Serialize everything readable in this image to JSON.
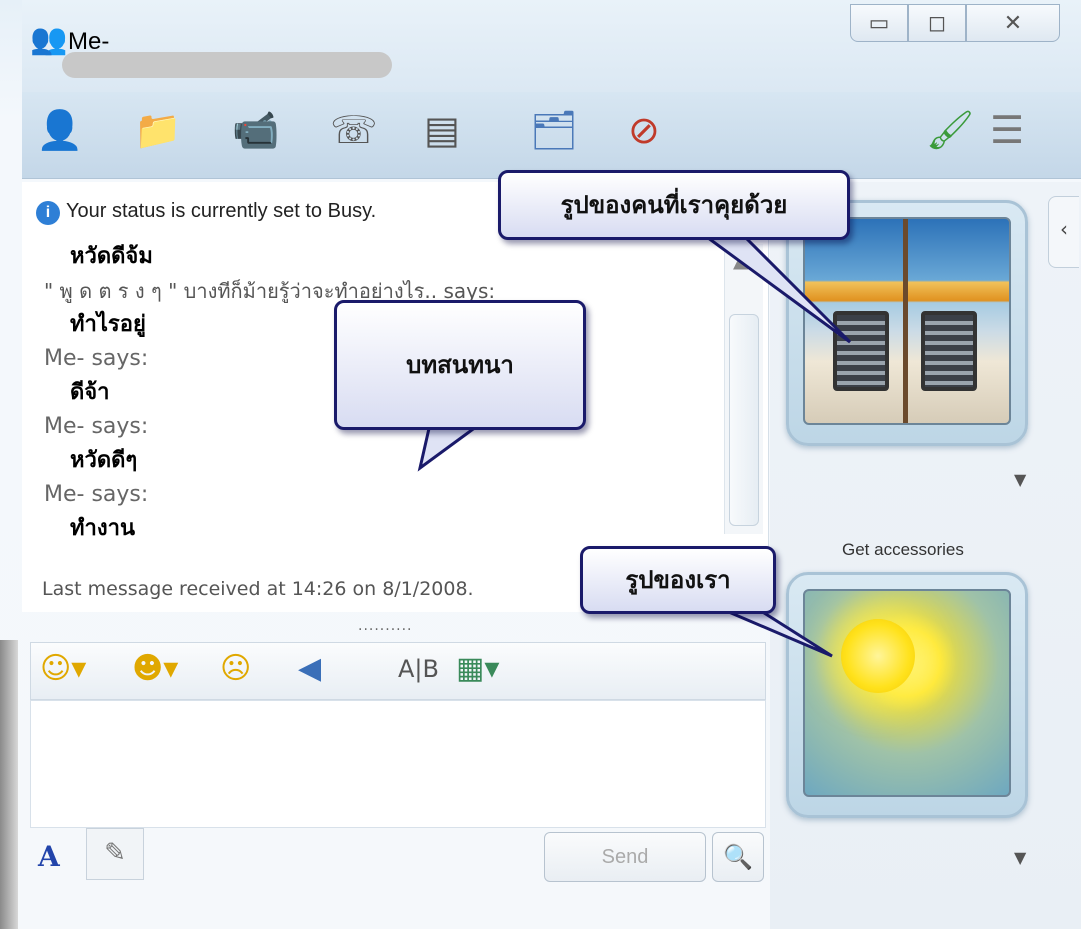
{
  "window": {
    "title": "Me-",
    "buttons": {
      "minimize": "▭",
      "restore": "◻",
      "close": "✕"
    }
  },
  "toolbar": {
    "icons": [
      "add-contact-icon",
      "share-folder-icon",
      "video-call-icon",
      "call-icon",
      "games-icon",
      "activities-icon",
      "block-icon",
      "paintbrush-icon",
      "menu-icon"
    ]
  },
  "status": {
    "text": "Your status is currently set to Busy."
  },
  "conversation": [
    {
      "kind": "msg",
      "text": "หวัดดีจ้ม"
    },
    {
      "kind": "sender-thai",
      "text": "\" พู ด ต ร ง ๆ \" บางทีก็ม้ายรู้ว่าจะทำอย่างไร.. says:"
    },
    {
      "kind": "msg",
      "text": "ทำไรอยู่"
    },
    {
      "kind": "sender",
      "text": "Me- says:"
    },
    {
      "kind": "msg",
      "text": "ดีจ้า"
    },
    {
      "kind": "sender",
      "text": "Me- says:"
    },
    {
      "kind": "msg",
      "text": "หวัดดีๆ"
    },
    {
      "kind": "sender",
      "text": "Me- says:"
    },
    {
      "kind": "msg",
      "text": "ทำงาน"
    }
  ],
  "last_message": "Last message received at 14:26 on 8/1/2008.",
  "splitter": "..........",
  "format_bar": {
    "icons": [
      "emoticon-icon",
      "wink-icon",
      "nudge-icon",
      "voice-clip-icon",
      "font-icon",
      "background-icon"
    ]
  },
  "compose": {
    "font_label": "A",
    "send_label": "Send"
  },
  "right_pane": {
    "get_accessories": "Get accessories"
  },
  "callouts": {
    "contact_picture": "รูปของคนที่เราคุยด้วย",
    "conversation": "บทสนทนา",
    "my_picture": "รูปของเรา"
  }
}
